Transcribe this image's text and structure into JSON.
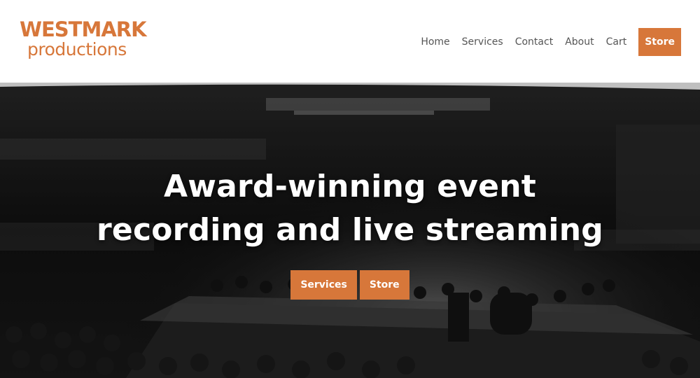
{
  "logo": {
    "line1": "WESTMARK",
    "line2": "productions"
  },
  "nav": {
    "items": [
      {
        "label": "Home"
      },
      {
        "label": "Services"
      },
      {
        "label": "Contact"
      },
      {
        "label": "About"
      },
      {
        "label": "Cart"
      }
    ],
    "store_label": "Store"
  },
  "hero": {
    "title_line1": "Award-winning event",
    "title_line2": "recording and live streaming",
    "buttons": [
      {
        "label": "Services"
      },
      {
        "label": "Store"
      }
    ]
  },
  "colors": {
    "accent": "#d7773a",
    "nav_text": "#555555"
  }
}
